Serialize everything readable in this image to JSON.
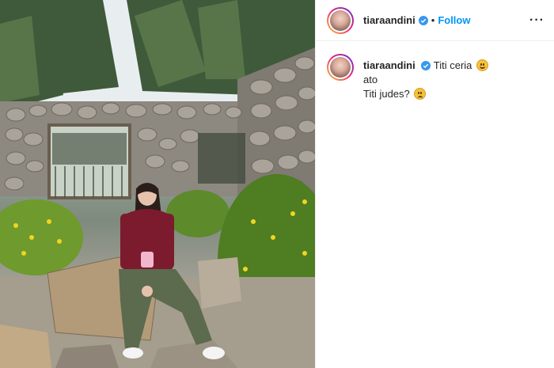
{
  "header": {
    "username": "tiaraandini",
    "separator": "•",
    "follow_label": "Follow",
    "more_label": "···"
  },
  "caption": {
    "username": "tiaraandini",
    "line1": "Titi ceria",
    "line2": "ato",
    "line3": "Titi judes?",
    "emoji1": "smiling-face-icon",
    "emoji2": "grumpy-face-icon"
  },
  "colors": {
    "follow": "#0095f6",
    "verified": "#3897f0",
    "divider": "#efefef"
  }
}
